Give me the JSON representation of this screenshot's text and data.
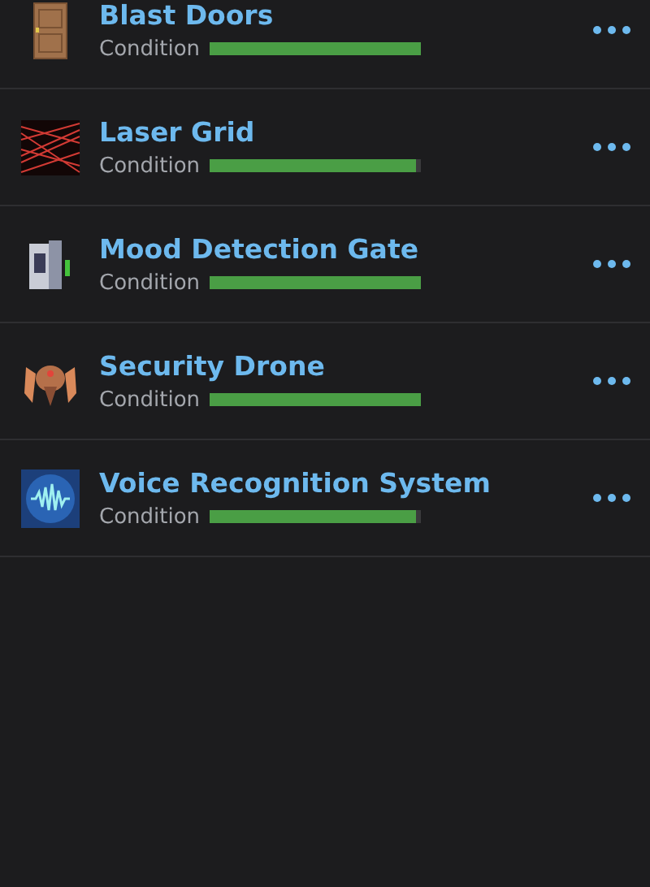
{
  "devices": [
    {
      "kind": "door",
      "name": "Blast Doors",
      "label": "Condition",
      "level": 1.0
    },
    {
      "kind": "laser",
      "name": "Laser Grid",
      "label": "Condition",
      "level": 0.98
    },
    {
      "kind": "gate",
      "name": "Mood Detection Gate",
      "label": "Condition",
      "level": 1.0
    },
    {
      "kind": "drone",
      "name": "Security Drone",
      "label": "Condition",
      "level": 1.0
    },
    {
      "kind": "voice",
      "name": "Voice Recognition System",
      "label": "Condition",
      "level": 0.98
    }
  ]
}
